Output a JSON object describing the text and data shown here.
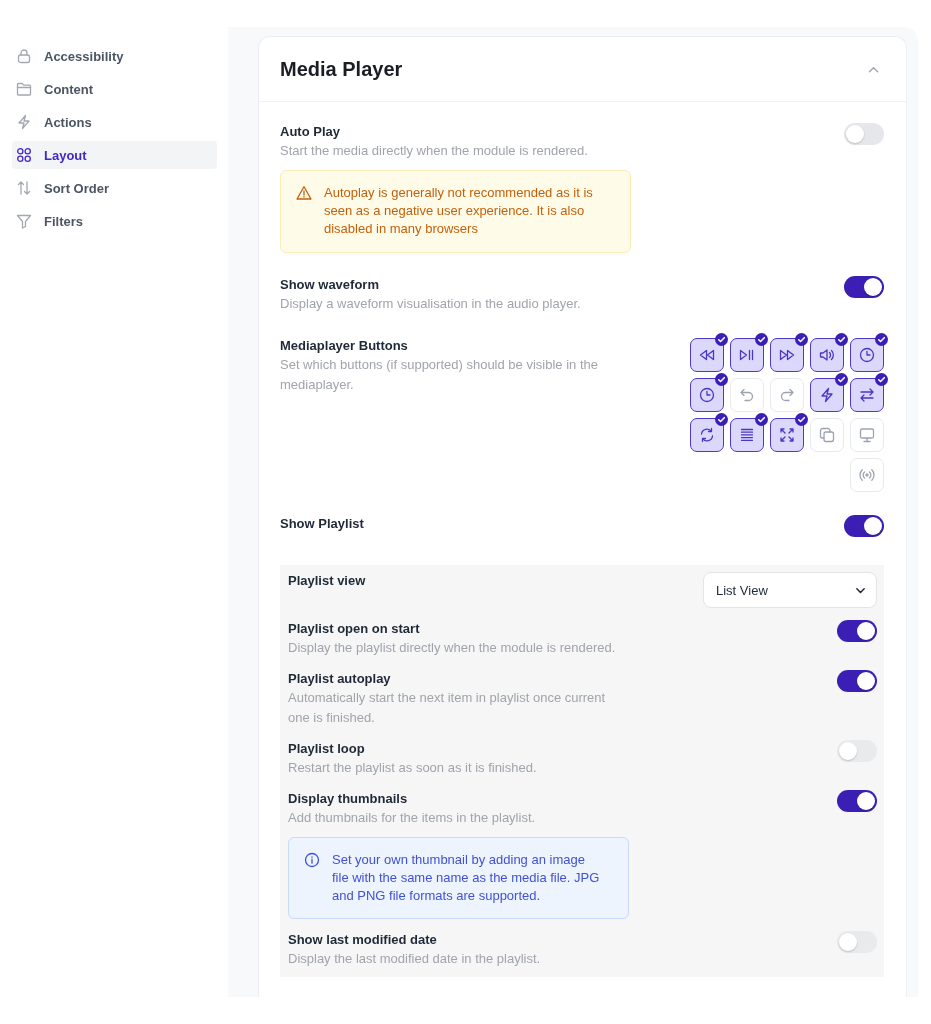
{
  "sidebar": {
    "items": [
      {
        "label": "Accessibility",
        "kind": "lock",
        "selected": false
      },
      {
        "label": "Content",
        "kind": "folder",
        "selected": false
      },
      {
        "label": "Actions",
        "kind": "lightning",
        "selected": false
      },
      {
        "label": "Layout",
        "kind": "grid",
        "selected": true
      },
      {
        "label": "Sort Order",
        "kind": "sort",
        "selected": false
      },
      {
        "label": "Filters",
        "kind": "filter",
        "selected": false
      }
    ]
  },
  "panel": {
    "title": "Media Player",
    "expanded": true,
    "settings": [
      {
        "kind": "toggle",
        "title": "Auto Play",
        "description": "Start the media directly when the module is rendered.",
        "on": false,
        "note": {
          "kind": "warning",
          "text": "Autoplay is generally not recommended as it is seen as a negative user experience. It is also disabled in many browsers"
        }
      },
      {
        "kind": "toggle",
        "title": "Show waveform",
        "description": "Display a waveform visualisation in the audio player.",
        "on": true
      },
      {
        "kind": "buttons",
        "title": "Mediaplayer Buttons",
        "description": "Set which buttons (if supported) should be visible in the mediaplayer.",
        "buttons": [
          {
            "kind": "rewind",
            "selected": true
          },
          {
            "kind": "play-pause",
            "selected": true
          },
          {
            "kind": "fast-forward",
            "selected": true
          },
          {
            "kind": "volume",
            "selected": true
          },
          {
            "kind": "clock",
            "selected": true
          },
          {
            "kind": "clock",
            "selected": true
          },
          {
            "kind": "undo",
            "selected": false
          },
          {
            "kind": "redo",
            "selected": false
          },
          {
            "kind": "lightning",
            "selected": true
          },
          {
            "kind": "swap",
            "selected": true
          },
          {
            "kind": "refresh",
            "selected": true
          },
          {
            "kind": "lines",
            "selected": true
          },
          {
            "kind": "expand",
            "selected": true
          },
          {
            "kind": "copy",
            "selected": false
          },
          {
            "kind": "monitor",
            "selected": false
          },
          {
            "kind": "broadcast",
            "selected": false
          }
        ]
      },
      {
        "kind": "toggle",
        "title": "Show Playlist",
        "on": true,
        "options": [
          {
            "kind": "select",
            "title": "Playlist view",
            "value": "List View"
          },
          {
            "kind": "toggle",
            "title": "Playlist open on start",
            "description": "Display the playlist directly when the module is rendered.",
            "on": true
          },
          {
            "kind": "toggle",
            "title": "Playlist autoplay",
            "description": "Automatically start the next item in playlist once current one is finished.",
            "on": true
          },
          {
            "kind": "toggle",
            "title": "Playlist loop",
            "description": "Restart the playlist as soon as it is finished.",
            "on": false
          },
          {
            "kind": "toggle",
            "title": "Display thumbnails",
            "description": "Add thumbnails for the items in the playlist.",
            "on": true,
            "note": {
              "kind": "info",
              "text": "Set your own thumbnail by adding an image file with the same name as the media file. JPG and PNG file formats are supported."
            }
          },
          {
            "kind": "toggle",
            "title": "Show last modified date",
            "description": "Display the last modified date in the playlist.",
            "on": false
          }
        ]
      }
    ]
  }
}
